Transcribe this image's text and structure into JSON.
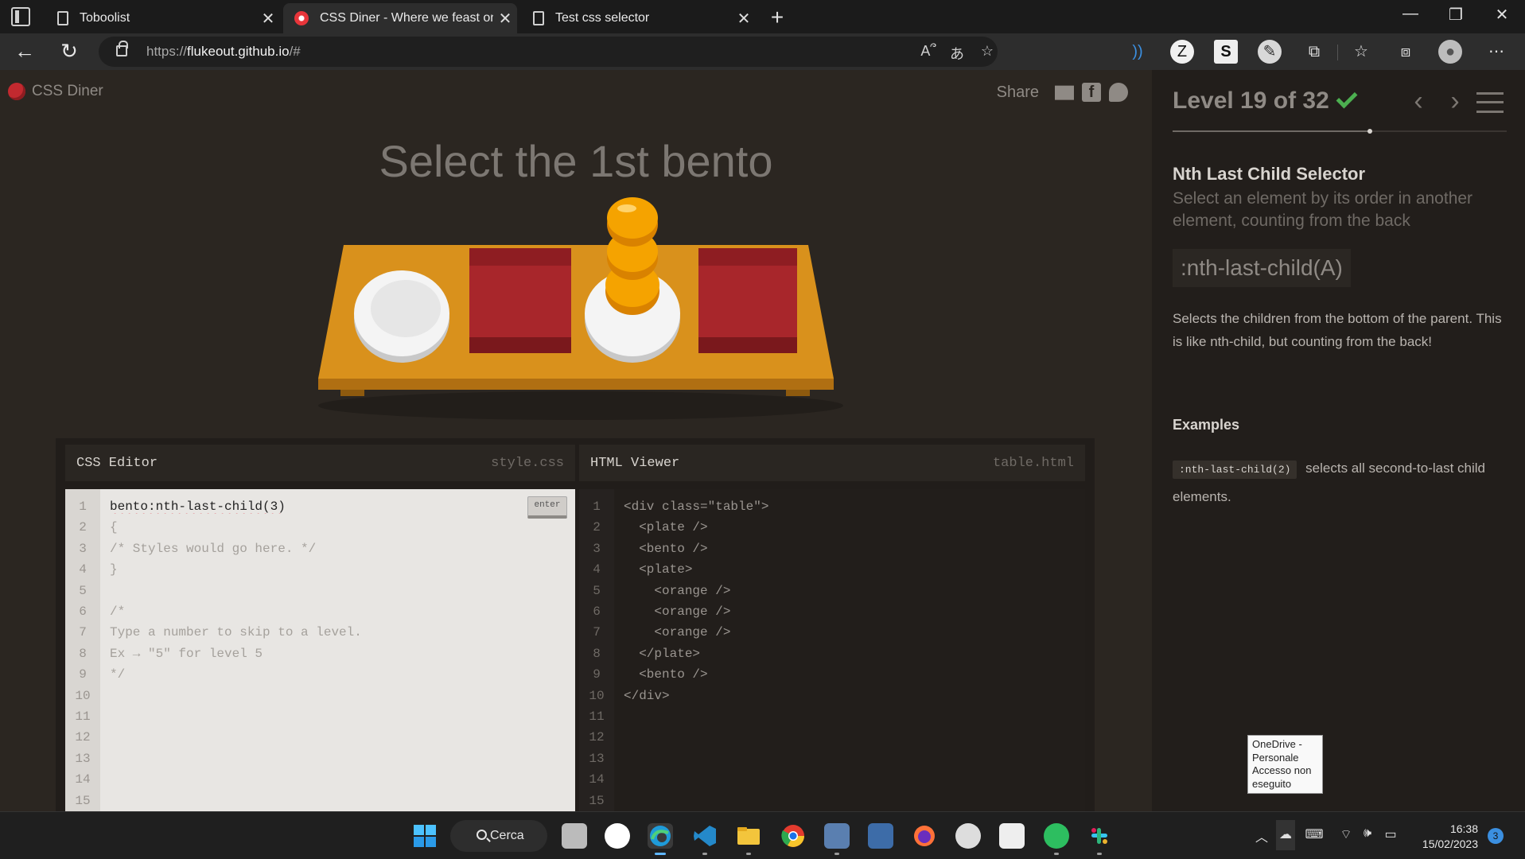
{
  "browser": {
    "tabs": [
      {
        "title": "Toboolist",
        "close": "✕"
      },
      {
        "title": "CSS Diner - Where we feast on CSS Selectors!",
        "close": "✕"
      },
      {
        "title": "Test css selector",
        "close": "✕"
      }
    ],
    "new_tab": "+",
    "window_controls": {
      "minimize": "—",
      "restore": "❐",
      "close": "✕"
    },
    "url_prefix": "https://",
    "url_host": "flukeout.github.io",
    "url_rest": "/#",
    "toolbar_icons": [
      "read-aloud-icon",
      "translate-icon",
      "favorite-add-icon",
      "dolby-icon",
      "zotero-icon",
      "s-extension-icon",
      "profile-extension-icon",
      "extensions-icon",
      "favorites-icon",
      "collections-icon",
      "profile-icon",
      "more-icon"
    ]
  },
  "game": {
    "logo": "CSS Diner",
    "share_label": "Share",
    "order": "Select the 1st bento",
    "css_editor": {
      "title": "CSS Editor",
      "file": "style.css",
      "input_value": "bento:nth-last-child(3)",
      "enter_label": "enter",
      "lines": [
        "{",
        "/* Styles would go here. */",
        "}",
        "",
        "/*",
        "Type a number to skip to a level.",
        "Ex → \"5\" for level 5",
        "*/"
      ],
      "line_numbers": [
        "1",
        "2",
        "3",
        "4",
        "5",
        "6",
        "7",
        "8",
        "9",
        "10",
        "11",
        "12",
        "13",
        "14",
        "15"
      ]
    },
    "html_viewer": {
      "title": "HTML Viewer",
      "file": "table.html",
      "lines": [
        "<div class=\"table\">",
        "  <plate />",
        "  <bento />",
        "  <plate>",
        "    <orange />",
        "    <orange />",
        "    <orange />",
        "  </plate>",
        "  <bento />",
        "</div>"
      ],
      "line_numbers": [
        "1",
        "2",
        "3",
        "4",
        "5",
        "6",
        "7",
        "8",
        "9",
        "10",
        "11",
        "12",
        "13",
        "14",
        "15"
      ]
    }
  },
  "sidebar": {
    "level_text": "Level 19 of 32",
    "completed": true,
    "progress": 0.59,
    "prev": "‹",
    "next": "›",
    "selector_name": "Nth Last Child Selector",
    "title": "Select an element by its order in another element, counting from the back",
    "syntax": ":nth-last-child(A)",
    "hint": "Selects the children from the bottom of the parent. This is like nth-child, but counting from the back!",
    "examples_title": "Examples",
    "example_code": ":nth-last-child(2)",
    "example_text": "selects all second-to-last child elements."
  },
  "tooltip": "OneDrive - Personale Accesso non eseguito",
  "taskbar": {
    "search_label": "Cerca",
    "time": "16:38",
    "date": "15/02/2023",
    "notifications": "3"
  },
  "colors": {
    "plate": "#f4f4f4",
    "bento": "#a8262b",
    "orange": "#f5a300",
    "table": "#d9911c",
    "check": "#4caf50"
  }
}
